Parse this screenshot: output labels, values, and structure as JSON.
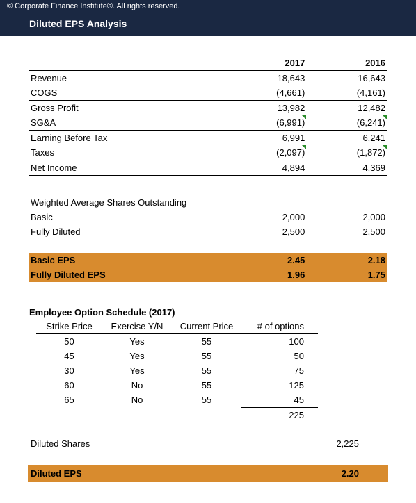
{
  "header": {
    "copyright": "© Corporate Finance Institute®. All rights reserved.",
    "title": "Diluted EPS Analysis"
  },
  "years": {
    "y1": "2017",
    "y2": "2016"
  },
  "income": {
    "revenue_label": "Revenue",
    "revenue_y1": "18,643",
    "revenue_y2": "16,643",
    "cogs_label": "COGS",
    "cogs_y1": "(4,661)",
    "cogs_y2": "(4,161)",
    "gp_label": "Gross Profit",
    "gp_y1": "13,982",
    "gp_y2": "12,482",
    "sga_label": "SG&A",
    "sga_y1": "(6,991)",
    "sga_y2": "(6,241)",
    "ebt_label": "Earning Before  Tax",
    "ebt_y1": "6,991",
    "ebt_y2": "6,241",
    "tax_label": "Taxes",
    "tax_y1": "(2,097)",
    "tax_y2": "(1,872)",
    "ni_label": "Net Income",
    "ni_y1": "4,894",
    "ni_y2": "4,369"
  },
  "shares": {
    "heading": "Weighted Average Shares Outstanding",
    "basic_label": "Basic",
    "basic_y1": "2,000",
    "basic_y2": "2,000",
    "fd_label": "Fully Diluted",
    "fd_y1": "2,500",
    "fd_y2": "2,500"
  },
  "eps": {
    "basic_label": "Basic EPS",
    "basic_y1": "2.45",
    "basic_y2": "2.18",
    "fd_label": "Fully Diluted EPS",
    "fd_y1": "1.96",
    "fd_y2": "1.75"
  },
  "options": {
    "heading": "Employee Option Schedule (2017)",
    "col_strike": "Strike Price",
    "col_exercise": "Exercise Y/N",
    "col_current": "Current Price",
    "col_num": "# of options",
    "rows": [
      {
        "strike": "50",
        "ex": "Yes",
        "cur": "55",
        "n": "100"
      },
      {
        "strike": "45",
        "ex": "Yes",
        "cur": "55",
        "n": "50"
      },
      {
        "strike": "30",
        "ex": "Yes",
        "cur": "55",
        "n": "75"
      },
      {
        "strike": "60",
        "ex": "No",
        "cur": "55",
        "n": "125"
      },
      {
        "strike": "65",
        "ex": "No",
        "cur": "55",
        "n": "45"
      }
    ],
    "total": "225"
  },
  "diluted_shares": {
    "label": "Diluted Shares",
    "val": "2,225"
  },
  "diluted_eps": {
    "label": "Diluted EPS",
    "val": "2.20"
  }
}
